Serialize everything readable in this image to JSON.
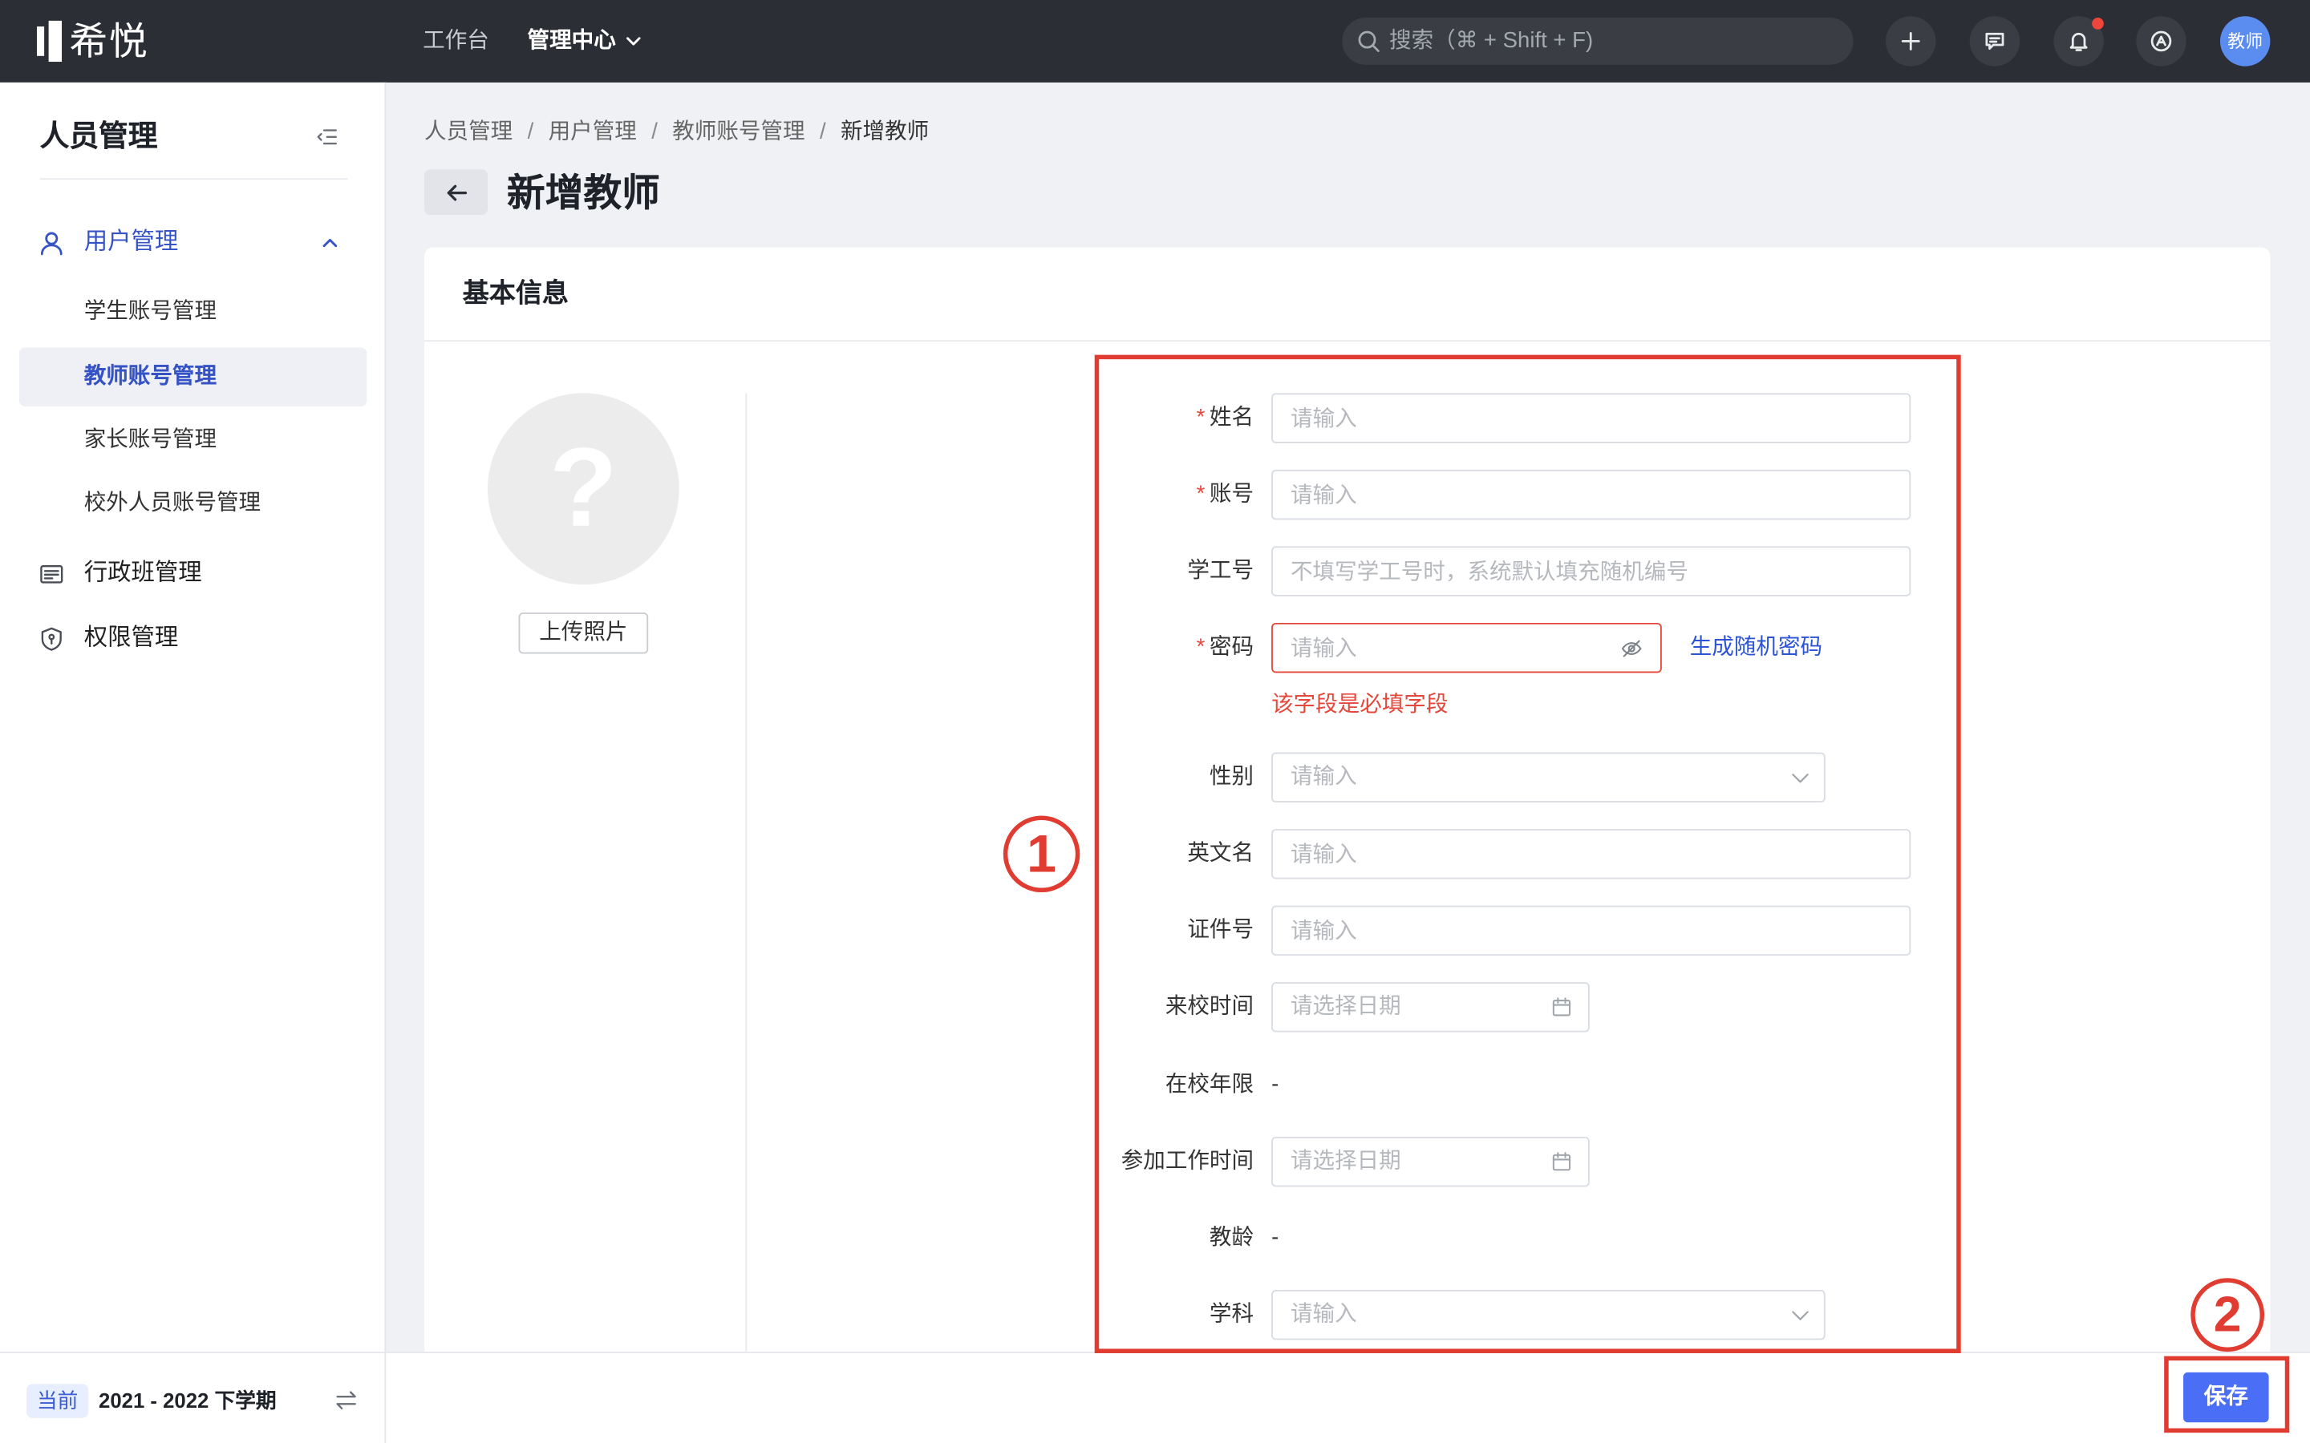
{
  "topbar": {
    "logo_text": "希悦",
    "nav": [
      {
        "label": "工作台",
        "active": false
      },
      {
        "label": "管理中心",
        "active": true
      }
    ],
    "search_placeholder": "搜索（⌘ + Shift + F)",
    "icons": [
      "plus-icon",
      "message-icon",
      "bell-icon",
      "identity-switch-icon"
    ],
    "notification_dot": true,
    "avatar_label": "教师"
  },
  "sidebar": {
    "title": "人员管理",
    "items": [
      {
        "label": "用户管理",
        "icon": "user-icon",
        "expanded": true,
        "children": [
          {
            "label": "学生账号管理",
            "active": false
          },
          {
            "label": "教师账号管理",
            "active": true
          },
          {
            "label": "家长账号管理",
            "active": false
          },
          {
            "label": "校外人员账号管理",
            "active": false
          }
        ]
      },
      {
        "label": "行政班管理",
        "icon": "class-card-icon"
      },
      {
        "label": "权限管理",
        "icon": "shield-icon"
      }
    ],
    "footer": {
      "badge": "当前",
      "term": "2021 - 2022 下学期"
    }
  },
  "main": {
    "breadcrumb": [
      "人员管理",
      "用户管理",
      "教师账号管理",
      "新增教师"
    ],
    "breadcrumb_separator": "/",
    "title": "新增教师",
    "card_title": "基本信息",
    "avatar_placeholder": "?",
    "upload_label": "上传照片"
  },
  "form": {
    "required_mark": "*",
    "fields": [
      {
        "label": "姓名",
        "required": true,
        "type": "text",
        "placeholder": "请输入"
      },
      {
        "label": "账号",
        "required": true,
        "type": "text",
        "placeholder": "请输入"
      },
      {
        "label": "学工号",
        "required": false,
        "type": "text",
        "placeholder": "不填写学工号时，系统默认填充随机编号"
      },
      {
        "label": "密码",
        "required": true,
        "type": "password",
        "placeholder": "请输入",
        "error": "该字段是必填字段",
        "action_link": "生成随机密码"
      },
      {
        "label": "性别",
        "required": false,
        "type": "select",
        "placeholder": "请输入"
      },
      {
        "label": "英文名",
        "required": false,
        "type": "text",
        "placeholder": "请输入"
      },
      {
        "label": "证件号",
        "required": false,
        "type": "text",
        "placeholder": "请输入"
      },
      {
        "label": "来校时间",
        "required": false,
        "type": "date",
        "placeholder": "请选择日期"
      },
      {
        "label": "在校年限",
        "required": false,
        "type": "readonly",
        "value": "-"
      },
      {
        "label": "参加工作时间",
        "required": false,
        "type": "date",
        "placeholder": "请选择日期"
      },
      {
        "label": "教龄",
        "required": false,
        "type": "readonly",
        "value": "-"
      },
      {
        "label": "学科",
        "required": false,
        "type": "select",
        "placeholder": "请输入"
      }
    ]
  },
  "footer": {
    "save_label": "保存"
  },
  "annotations": [
    {
      "label": "1",
      "target": "form-fields"
    },
    {
      "label": "2",
      "target": "save-button"
    }
  ],
  "colors": {
    "topbar_bg": "#2b2e34",
    "accent": "#3653c5",
    "link": "#2c53d6",
    "primary_button": "#4a6ef6",
    "error": "#e5483b",
    "annotation": "#e03c31",
    "avatar_bg": "#5b8cf0",
    "active_menu_bg": "#eef0f5"
  }
}
